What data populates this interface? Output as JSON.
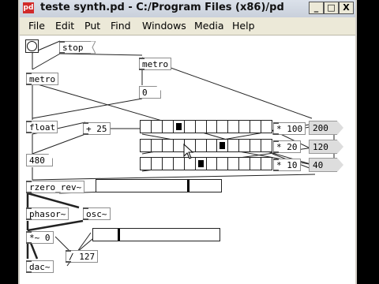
{
  "window": {
    "title": "teste synth.pd - C:/Program Files (x86)/pd",
    "app_icon": "pd-icon"
  },
  "controls": {
    "minimize": "_",
    "maximize": "□",
    "close": "X"
  },
  "menu": {
    "file": "File",
    "edit": "Edit",
    "put": "Put",
    "find": "Find",
    "windows": "Windows",
    "media": "Media",
    "help": "Help"
  },
  "patch": {
    "stop_msg": "stop",
    "metro_left": "metro",
    "metro_right": "metro",
    "number_zero": "0",
    "float_obj": "float",
    "plus_obj": "+ 25",
    "number_480": "480",
    "rzero_obj": "rzero_rev~",
    "phasor_obj": "phasor~",
    "osc_obj": "osc~",
    "mul_sig_obj": "*~ 0",
    "div_obj": "/ 127",
    "dac_obj": "dac~",
    "mul_100": "* 100",
    "mul_20": "* 20",
    "mul_10": "* 10",
    "msg_200": "200",
    "msg_120": "120",
    "msg_40": "40"
  },
  "gui": {
    "radio_rows": [
      {
        "cells": 12,
        "selected_index": 3
      },
      {
        "cells": 12,
        "selected_index": 7
      },
      {
        "cells": 12,
        "selected_index": 5
      }
    ],
    "slider_top_fraction": 0.74,
    "slider_bottom_fraction": 0.2
  }
}
